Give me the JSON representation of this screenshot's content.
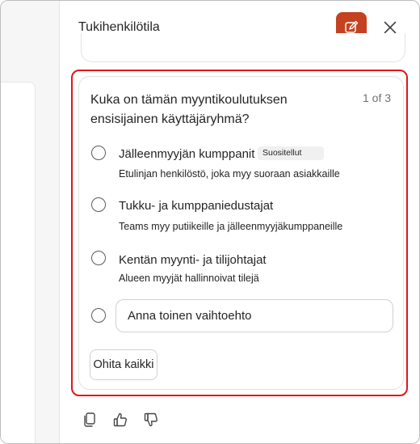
{
  "panel": {
    "title": "Tukihenkilötila"
  },
  "question": {
    "text": "Kuka on tämän myyntikoulutuksen ensisijainen käyttäjäryhmä?",
    "counter": "1 of 3",
    "recommended_badge": "Suositellut",
    "options": [
      {
        "title": "Jälleenmyyjän kumppanit",
        "description": "Etulinjan henkilöstö, joka myy suoraan asiakkaille"
      },
      {
        "title": "Tukku- ja kumppaniedustajat",
        "description": "Teams myy putiikeille ja jälleenmyyjäkumppaneille"
      },
      {
        "title": "Kentän myynti- ja tilijohtajat",
        "description": "Alueen myyjät hallinnoivat tilejä"
      }
    ],
    "other_placeholder": "Anna toinen vaihtoehto",
    "skip_label": "Ohita kaikki"
  },
  "colors": {
    "accent": "#c4421f",
    "highlight_border": "#e0161c"
  },
  "icons": [
    "edit-icon",
    "close-icon",
    "copy-icon",
    "thumbs-up-icon",
    "thumbs-down-icon"
  ]
}
